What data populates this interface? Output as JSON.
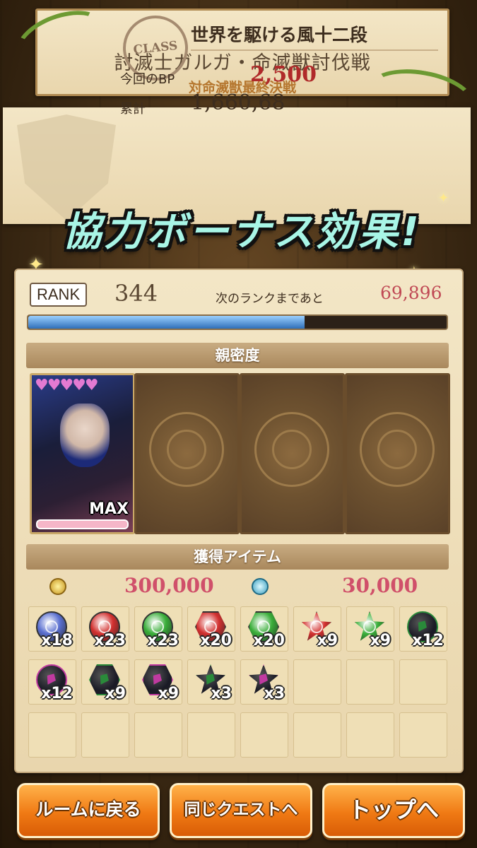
{
  "quest": {
    "title": "討滅士ガルガ・命滅獣討伐戦",
    "subtitle": "対命滅獣最終決戦"
  },
  "class_info": {
    "stamp": "CLASS",
    "name": "世界を駆ける風十二段",
    "bp_label": "今回のBP",
    "bp_value": "2,500",
    "total_label": "累計",
    "total_value": "1,660,68"
  },
  "bonus_title": "協力ボーナス効果!",
  "rank": {
    "label": "RANK",
    "value": "344",
    "next_label": "次のランクまであと",
    "next_value": "69,896",
    "progress": 0.66
  },
  "intimacy": {
    "header": "親密度",
    "cards": [
      {
        "hearts": "♥♥♥♥♥",
        "level": "MAX"
      },
      {},
      {},
      {}
    ]
  },
  "items": {
    "header": "獲得アイテム",
    "gold_value": "300,000",
    "soul_value": "30,000",
    "slots": [
      {
        "type": "medal",
        "color": "#5a6fd0",
        "qty": "x18"
      },
      {
        "type": "round",
        "color": "#d2302f",
        "qty": "x23"
      },
      {
        "type": "round",
        "color": "#3aae3a",
        "qty": "x23"
      },
      {
        "type": "hex",
        "color": "#d2302f",
        "qty": "x20"
      },
      {
        "type": "hex",
        "color": "#3aae3a",
        "qty": "x20"
      },
      {
        "type": "star",
        "color": "#d2302f",
        "qty": "x9"
      },
      {
        "type": "star",
        "color": "#3aae3a",
        "qty": "x9"
      },
      {
        "type": "dark-round",
        "color": "#2a8a3a",
        "qty": "x12"
      },
      {
        "type": "dark-round",
        "color": "#c03aa0",
        "qty": "x12"
      },
      {
        "type": "dark-hex",
        "color": "#2a8a3a",
        "qty": "x9"
      },
      {
        "type": "dark-hex",
        "color": "#c03aa0",
        "qty": "x9"
      },
      {
        "type": "dark-star",
        "color": "#2a8a3a",
        "qty": "x3"
      },
      {
        "type": "dark-star",
        "color": "#c03aa0",
        "qty": "x3"
      },
      {},
      {},
      {},
      {},
      {},
      {},
      {},
      {},
      {},
      {},
      {}
    ]
  },
  "buttons": {
    "room": "ルームに戻る",
    "same_quest": "同じクエストへ",
    "top": "トップへ"
  }
}
